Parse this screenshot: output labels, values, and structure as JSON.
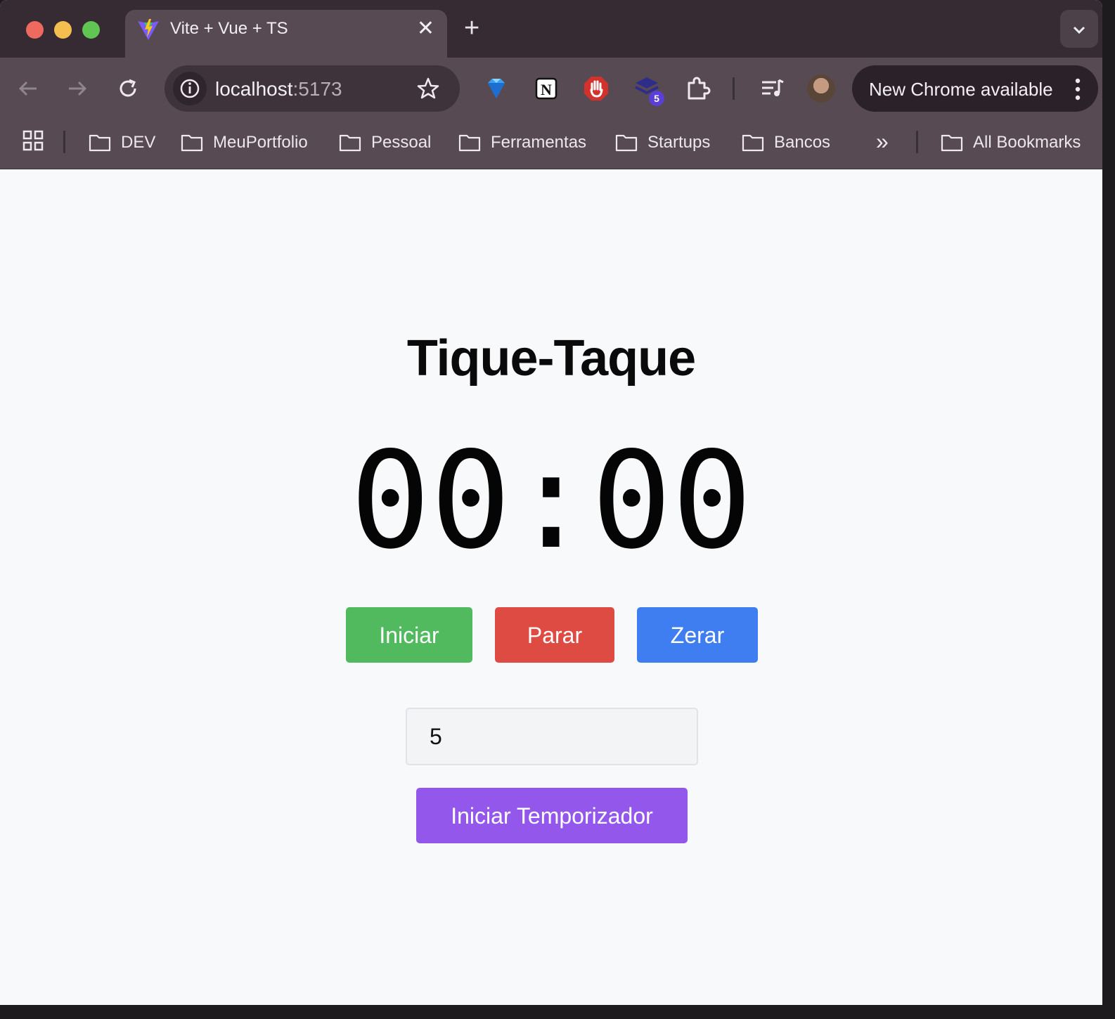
{
  "browser": {
    "tab": {
      "title": "Vite + Vue + TS",
      "close": "✕"
    },
    "new_tab": "+",
    "url": {
      "host": "localhost",
      "port": ":5173"
    },
    "extension_badge": "5",
    "update_label": "New Chrome available",
    "bookmarks": [
      "DEV",
      "MeuPortfolio",
      "Pessoal",
      "Ferramentas",
      "Startups",
      "Bancos"
    ],
    "bookmarks_overflow": "»",
    "all_bookmarks": "All Bookmarks",
    "icons": [
      "back-icon",
      "forward-icon",
      "reload-icon",
      "info-icon",
      "star-icon",
      "gem-extension-icon",
      "notion-icon",
      "adblock-icon",
      "layers-extension-icon",
      "extensions-icon",
      "media-icon",
      "profile-avatar",
      "menu-icon",
      "apps-grid-icon",
      "folder-icon"
    ]
  },
  "app": {
    "title": "Tique-Taque",
    "timer": "00:00",
    "buttons": {
      "start": "Iniciar",
      "stop": "Parar",
      "reset": "Zerar",
      "countdown": "Iniciar Temporizador"
    },
    "minutes_value": "5"
  },
  "colors": {
    "start": "#51b95e",
    "stop": "#dd4b43",
    "reset": "#3f7ef0",
    "countdown": "#9457ec",
    "page_bg": "#f8f9fb"
  }
}
